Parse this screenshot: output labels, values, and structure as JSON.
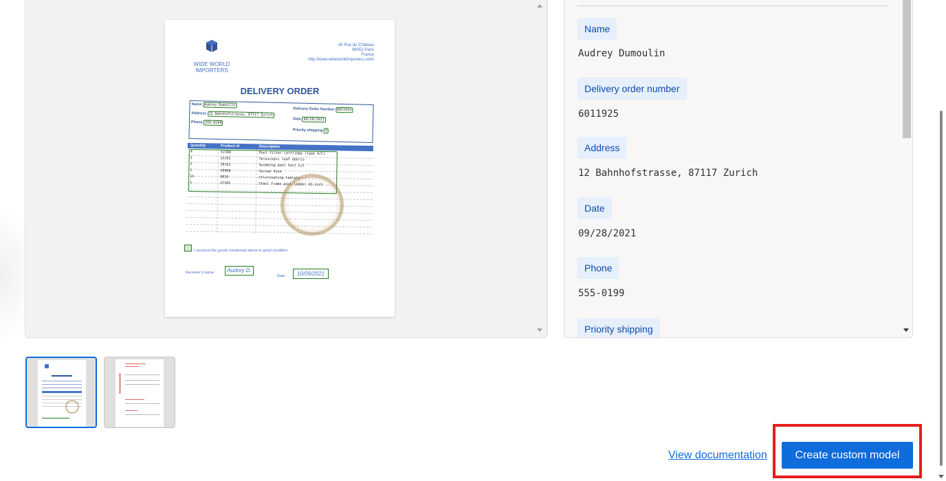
{
  "document": {
    "company": "WIDE WORLD IMPORTERS",
    "address_lines": [
      "45 Rue du Château",
      "98052 Paris",
      "France",
      "http://www.wideworldimporters.com/"
    ],
    "title": "DELIVERY ORDER",
    "labels": {
      "name": "Name",
      "address": "Address",
      "phone": "Phone",
      "order_number": "Delivery Order Number",
      "date": "Date",
      "priority": "Priority shipping"
    },
    "values": {
      "name": "Audrey Dumoulin",
      "address": "12 Bahnhofstrasse, 87117 Zurich",
      "phone": "555-0199",
      "order_number": "6011925",
      "date": "09/28/2021",
      "priority": "X"
    },
    "items_headers": [
      "Quantity",
      "Product id",
      "Description"
    ],
    "items": [
      {
        "qty": "4",
        "id": "52380",
        "desc": "Pool filter cartridge (type A/C)"
      },
      {
        "qty": "2",
        "id": "32262",
        "desc": "Telescopic leaf debris"
      },
      {
        "qty": "2",
        "id": "30162",
        "desc": "Swimming pool test kit"
      },
      {
        "qty": "1",
        "id": "59908",
        "desc": "Vacuum hose"
      },
      {
        "qty": "15",
        "id": "9019",
        "desc": "Chlorinating tablets"
      },
      {
        "qty": "1",
        "id": "37105",
        "desc": "Steel frame pool ladder 42-inch"
      }
    ],
    "received_text": "I received the goods mentioned above in good condition",
    "receiver_label": "Receiver's name:",
    "receiver_signature": "Audrey D.",
    "date_label": "Date",
    "signed_date": "10/09/2021"
  },
  "fields": [
    {
      "label": "Name",
      "value": "Audrey Dumoulin"
    },
    {
      "label": "Delivery order number",
      "value": "6011925"
    },
    {
      "label": "Address",
      "value": "12 Bahnhofstrasse, 87117 Zurich"
    },
    {
      "label": "Date",
      "value": "09/28/2021"
    },
    {
      "label": "Phone",
      "value": "555-0199"
    },
    {
      "label": "Priority shipping",
      "value": ""
    }
  ],
  "thumbnails": [
    {
      "selected": true
    },
    {
      "selected": false
    }
  ],
  "footer": {
    "view_documentation": "View documentation",
    "create_model": "Create custom model"
  },
  "colors": {
    "accent": "#0f6cdb",
    "field_tag_bg": "#e6effc",
    "field_tag_text": "#0f4ba8",
    "highlight": "#e81c1c",
    "detected_box": "#1f7a1f"
  }
}
